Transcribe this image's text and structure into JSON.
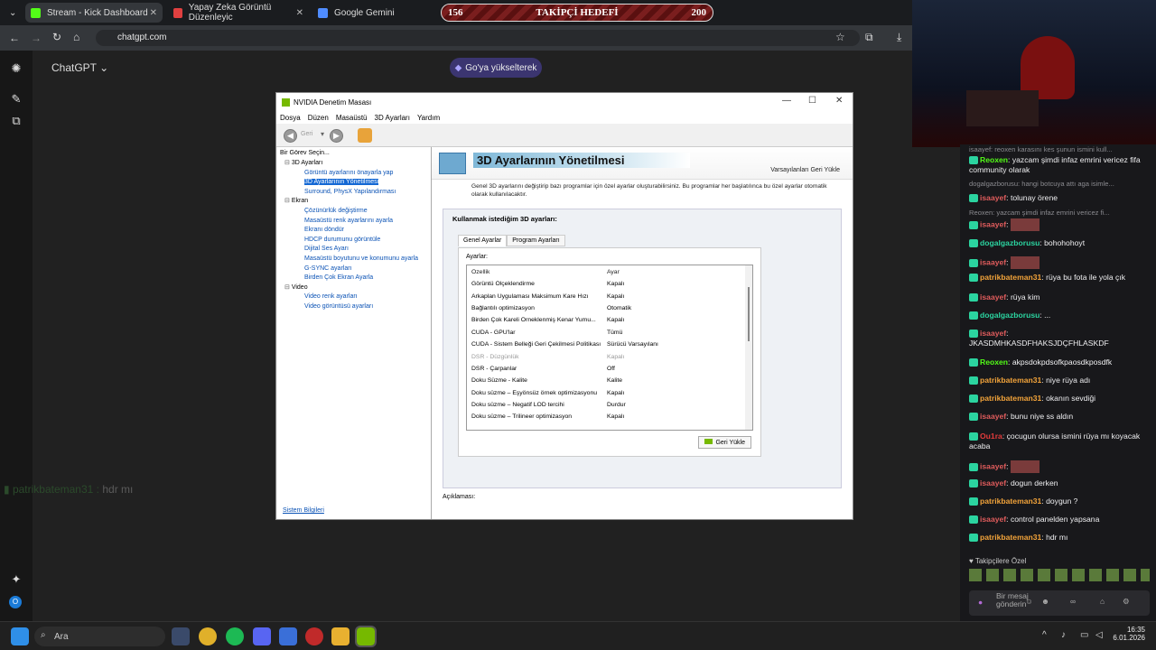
{
  "browser": {
    "tabs": [
      {
        "label": "Stream - Kick Dashboard",
        "color": "#53fc18"
      },
      {
        "label": "Yapay Zeka Görüntü Düzenleyic",
        "color": "#e04040"
      },
      {
        "label": "Google Gemini",
        "color": "#4f8cff"
      }
    ],
    "url": "chatgpt.com"
  },
  "goal": {
    "start": "156",
    "label": "TAKİPÇİ HEDEFİ",
    "end": "200"
  },
  "chatgpt": {
    "title": "ChatGPT",
    "upgrade": "Go'ya yükselterek",
    "ghost_text": "hdr mı"
  },
  "nvidia": {
    "title": "NVIDIA Denetim Masası",
    "menu": [
      "Dosya",
      "Düzen",
      "Masaüstü",
      "3D Ayarları",
      "Yardım"
    ],
    "back": "Geri",
    "task_label": "Bir Görev Seçin...",
    "tree": [
      {
        "type": "cat",
        "label": "3D Ayarları"
      },
      {
        "type": "it",
        "label": "Görüntü ayarlarını önayarla yap"
      },
      {
        "type": "sel",
        "label": "3D Ayarlarının Yönetilmesi"
      },
      {
        "type": "it",
        "label": "Surround, PhysX Yapılandırması"
      },
      {
        "type": "cat",
        "label": "Ekran"
      },
      {
        "type": "it",
        "label": "Çözünürlük değiştirme"
      },
      {
        "type": "it",
        "label": "Masaüstü renk ayarlarını ayarla"
      },
      {
        "type": "it",
        "label": "Ekranı döndür"
      },
      {
        "type": "it",
        "label": "HDCP durumunu görüntüle"
      },
      {
        "type": "it",
        "label": "Dijital Ses Ayarı"
      },
      {
        "type": "it",
        "label": "Masaüstü boyutunu ve konumunu ayarla"
      },
      {
        "type": "it",
        "label": "G-SYNC ayarları"
      },
      {
        "type": "it",
        "label": "Birden Çok Ekran Ayarla"
      },
      {
        "type": "cat",
        "label": "Video"
      },
      {
        "type": "it",
        "label": "Video renk ayarları"
      },
      {
        "type": "it",
        "label": "Video görüntüsü ayarları"
      }
    ],
    "sysinfo": "Sistem Bilgileri",
    "heading": "3D Ayarlarının Yönetilmesi",
    "restore_defaults": "Varsayılanları Geri Yükle",
    "description": "Genel 3D ayarlarını değiştirip bazı programlar için özel ayarlar oluşturabilirsiniz. Bu programlar her başlatılınca bu özel ayarlar otomatik olarak kullanılacaktır.",
    "group_title": "Kullanmak istediğim 3D ayarları:",
    "tab_global": "Genel Ayarlar",
    "tab_program": "Program Ayarları",
    "settings_label": "Ayarlar:",
    "col_feature": "Özellik",
    "col_setting": "Ayar",
    "rows": [
      [
        "Görüntü Ölçeklendirme",
        "Kapalı"
      ],
      [
        "Arkaplan Uygulaması Maksimum Kare Hızı",
        "Kapalı"
      ],
      [
        "Bağlantılı optimizasyon",
        "Otomatik"
      ],
      [
        "Birden Çok Kareli Örneklenmiş Kenar Yumu...",
        "Kapalı"
      ],
      [
        "CUDA - GPU'lar",
        "Tümü"
      ],
      [
        "CUDA - Sistem Belleği Geri Çekilmesi Politikası",
        "Sürücü Varsayılanı"
      ],
      [
        "DSR - Düzgünlük",
        "Kapalı"
      ],
      [
        "DSR - Çarpanlar",
        "Off"
      ],
      [
        "Doku Süzme - Kalite",
        "Kalite"
      ],
      [
        "Doku süzme – Eşyönsüz örnek optimizasyonu",
        "Kapalı"
      ],
      [
        "Doku süzme – Negatif LOD tercihi",
        "Durdur"
      ],
      [
        "Doku süzme – Trilineer optimizasyon",
        "Kapalı"
      ]
    ],
    "reset_btn": "Geri Yükle",
    "aciklama": "Açıklaması:"
  },
  "chat": {
    "messages": [
      {
        "user": "Reoxen",
        "color": "#53fc18",
        "text": "yazcam şimdi infaz emrini vericez fifa community olarak"
      },
      {
        "sys": "dogalgazborusu: hangi botcuya attı aga isimle..."
      },
      {
        "user": "isaayef",
        "color": "#e05c5c",
        "text": "tolunay örene"
      },
      {
        "sys": "Reoxen: yazcam şimdi infaz emrini vericez fi..."
      },
      {
        "user": "isaayef",
        "color": "#e05c5c",
        "text": ""
      },
      {
        "user": "dogalgazborusu",
        "color": "#2bd4a0",
        "text": "bohohohoyt"
      },
      {
        "user": "isaayef",
        "color": "#e05c5c",
        "text": ""
      },
      {
        "user": "patrikbateman31",
        "color": "#f2a33a",
        "text": "rüya bu fota ile yola çık"
      },
      {
        "user": "isaayef",
        "color": "#e05c5c",
        "text": "rüya kim"
      },
      {
        "user": "dogalgazborusu",
        "color": "#2bd4a0",
        "text": "..."
      },
      {
        "user": "isaayef",
        "color": "#e05c5c",
        "text": "JKASDMHKASDFHAKSJDÇFHLASKDF"
      },
      {
        "user": "Reoxen",
        "color": "#53fc18",
        "text": "akpsdokpdsofkpaosdkposdfk"
      },
      {
        "user": "patrikbateman31",
        "color": "#f2a33a",
        "text": "niye rüya adı"
      },
      {
        "user": "patrikbateman31",
        "color": "#f2a33a",
        "text": "okanın sevdiği"
      },
      {
        "user": "isaayef",
        "color": "#e05c5c",
        "text": "bunu niye ss aldın"
      },
      {
        "user": "Ou1ra",
        "color": "#e23b3b",
        "text": "çocugun olursa ismini rüya mı koyacak acaba"
      },
      {
        "user": "isaayef",
        "color": "#e05c5c",
        "text": ""
      },
      {
        "user": "isaayef",
        "color": "#e05c5c",
        "text": "dogun derken"
      },
      {
        "user": "patrikbateman31",
        "color": "#f2a33a",
        "text": "doygun ?"
      },
      {
        "user": "isaayef",
        "color": "#e05c5c",
        "text": "control panelden yapsana"
      },
      {
        "user": "patrikbateman31",
        "color": "#f2a33a",
        "text": "hdr mı"
      }
    ],
    "followers_only": "Takipçilere Özel",
    "input_placeholder": "Bir mesaj gönderin",
    "clipped_top": "isaayef: reoxen karasını kes şunun ismini kull..."
  },
  "taskbar": {
    "search": "Ara",
    "time": "16:35",
    "date": "6.01.2026"
  }
}
